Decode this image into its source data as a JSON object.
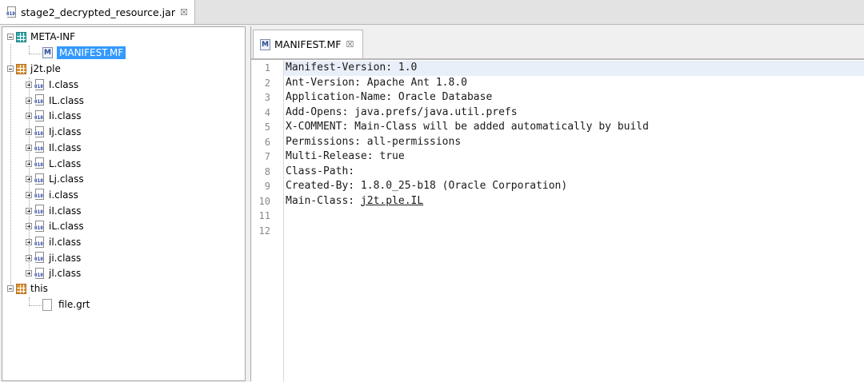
{
  "top_tab": {
    "label": "stage2_decrypted_resource.jar",
    "close": "☒"
  },
  "tree": {
    "meta_inf": {
      "label": "META-INF",
      "children": [
        {
          "label": "MANIFEST.MF"
        }
      ]
    },
    "package_j2t": {
      "label": "j2t.ple",
      "children": [
        "I.class",
        "IL.class",
        "Ii.class",
        "Ij.class",
        "Il.class",
        "L.class",
        "Lj.class",
        "i.class",
        "iI.class",
        "iL.class",
        "il.class",
        "ji.class",
        "jl.class"
      ]
    },
    "package_this": {
      "label": "this",
      "children": [
        {
          "label": "file.grt"
        }
      ]
    }
  },
  "editor": {
    "tab_label": "MANIFEST.MF",
    "tab_close": "☒",
    "lines": [
      {
        "no": "1",
        "text": "Manifest-Version: 1.0"
      },
      {
        "no": "2",
        "text": "Ant-Version: Apache Ant 1.8.0"
      },
      {
        "no": "3",
        "text": "Application-Name: Oracle Database"
      },
      {
        "no": "4",
        "text": "Add-Opens: java.prefs/java.util.prefs"
      },
      {
        "no": "5",
        "text": "X-COMMENT: Main-Class will be added automatically by build"
      },
      {
        "no": "6",
        "text": "Permissions: all-permissions"
      },
      {
        "no": "7",
        "text": "Multi-Release: true"
      },
      {
        "no": "8",
        "text": "Class-Path:"
      },
      {
        "no": "9",
        "text": "Created-By: 1.8.0_25-b18 (Oracle Corporation)"
      },
      {
        "no": "10",
        "text": "Main-Class: ",
        "link": "j2t.ple.IL"
      },
      {
        "no": "11",
        "text": ""
      },
      {
        "no": "12",
        "text": ""
      }
    ]
  },
  "icons": {
    "class_bits": "010",
    "manifest_letter": "M"
  }
}
